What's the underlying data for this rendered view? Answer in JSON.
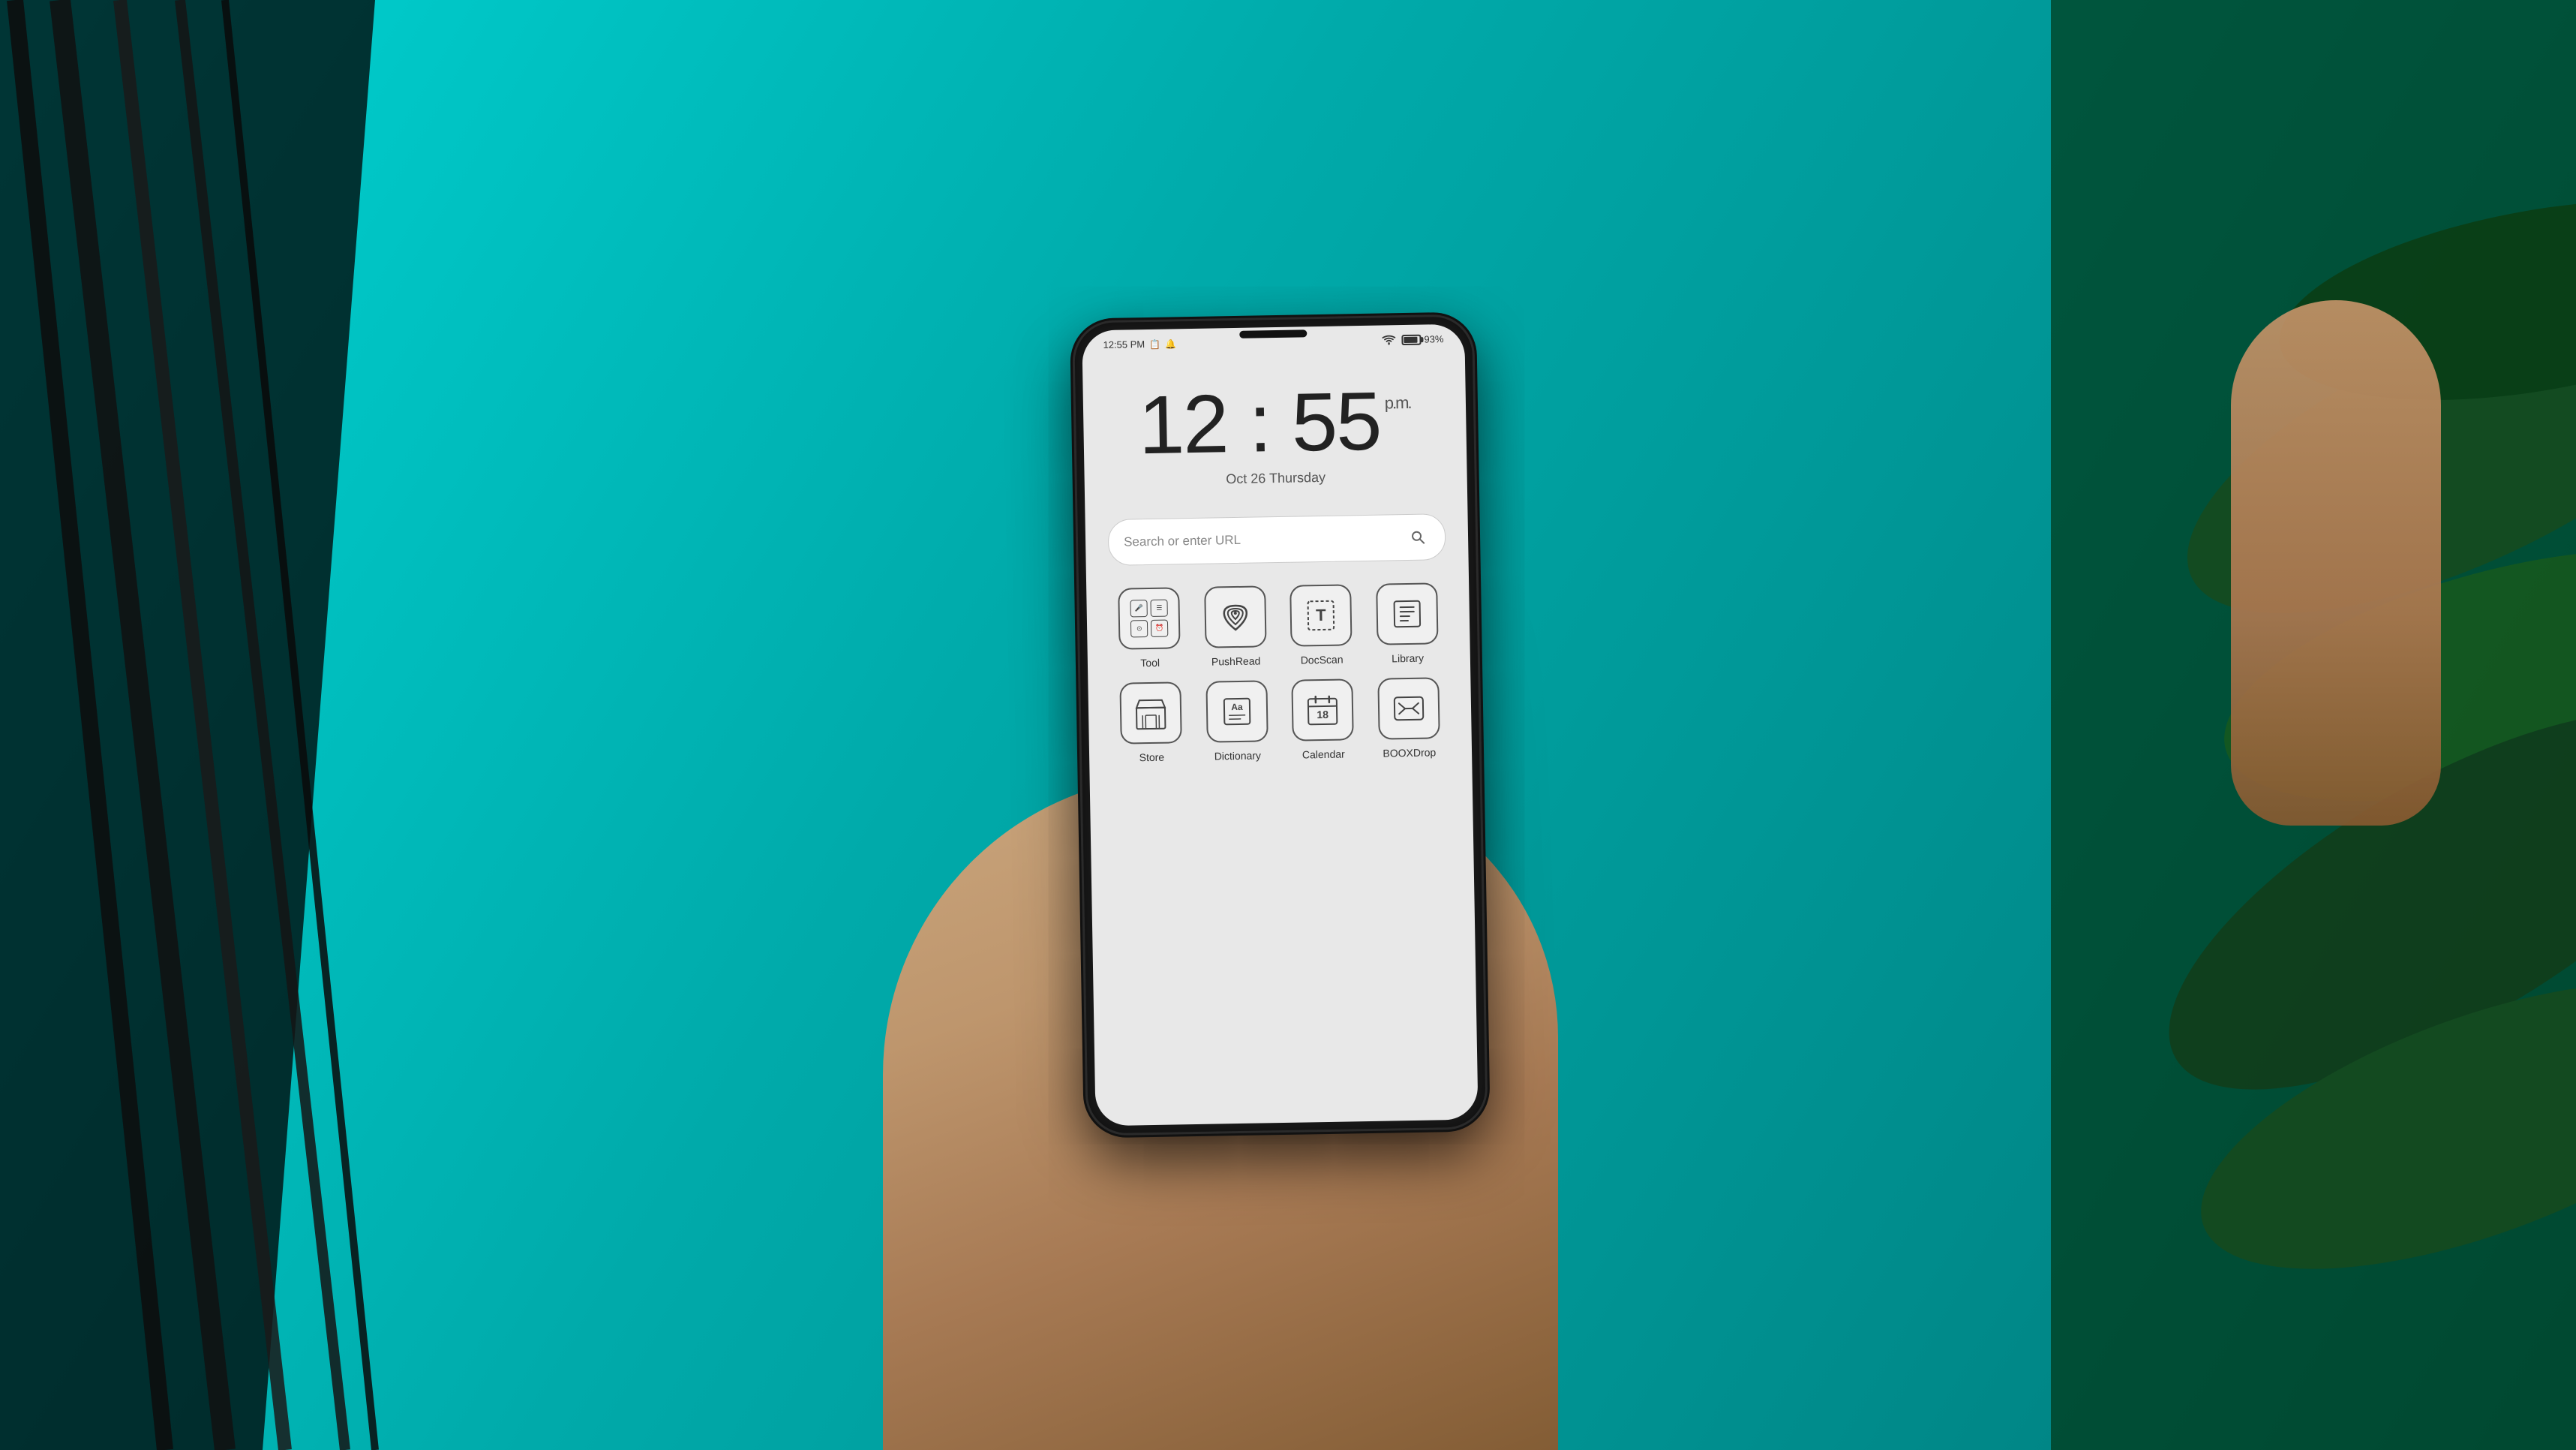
{
  "background": {
    "description": "Hand holding an e-ink tablet/phone against teal background with plants"
  },
  "status_bar": {
    "time": "12:55 PM",
    "battery_percent": "93%",
    "wifi": true,
    "notification_icons": [
      "📋",
      "🔔"
    ]
  },
  "clock": {
    "time_display": "12 : 55",
    "ampm": "p.m.",
    "date": "Oct 26 Thursday"
  },
  "search": {
    "placeholder": "Search or enter URL"
  },
  "apps_row1": [
    {
      "id": "tool",
      "label": "Tool",
      "icon_type": "tool"
    },
    {
      "id": "pushread",
      "label": "PushRead",
      "icon_type": "pushread"
    },
    {
      "id": "docscan",
      "label": "DocScan",
      "icon_type": "docscan"
    },
    {
      "id": "library",
      "label": "Library",
      "icon_type": "library"
    }
  ],
  "apps_row2": [
    {
      "id": "store",
      "label": "Store",
      "icon_type": "store"
    },
    {
      "id": "dictionary",
      "label": "Dictionary",
      "icon_type": "dictionary"
    },
    {
      "id": "calendar",
      "label": "Calendar",
      "icon_type": "calendar"
    },
    {
      "id": "booxdrop",
      "label": "BOOXDrop",
      "icon_type": "booxdrop"
    }
  ]
}
